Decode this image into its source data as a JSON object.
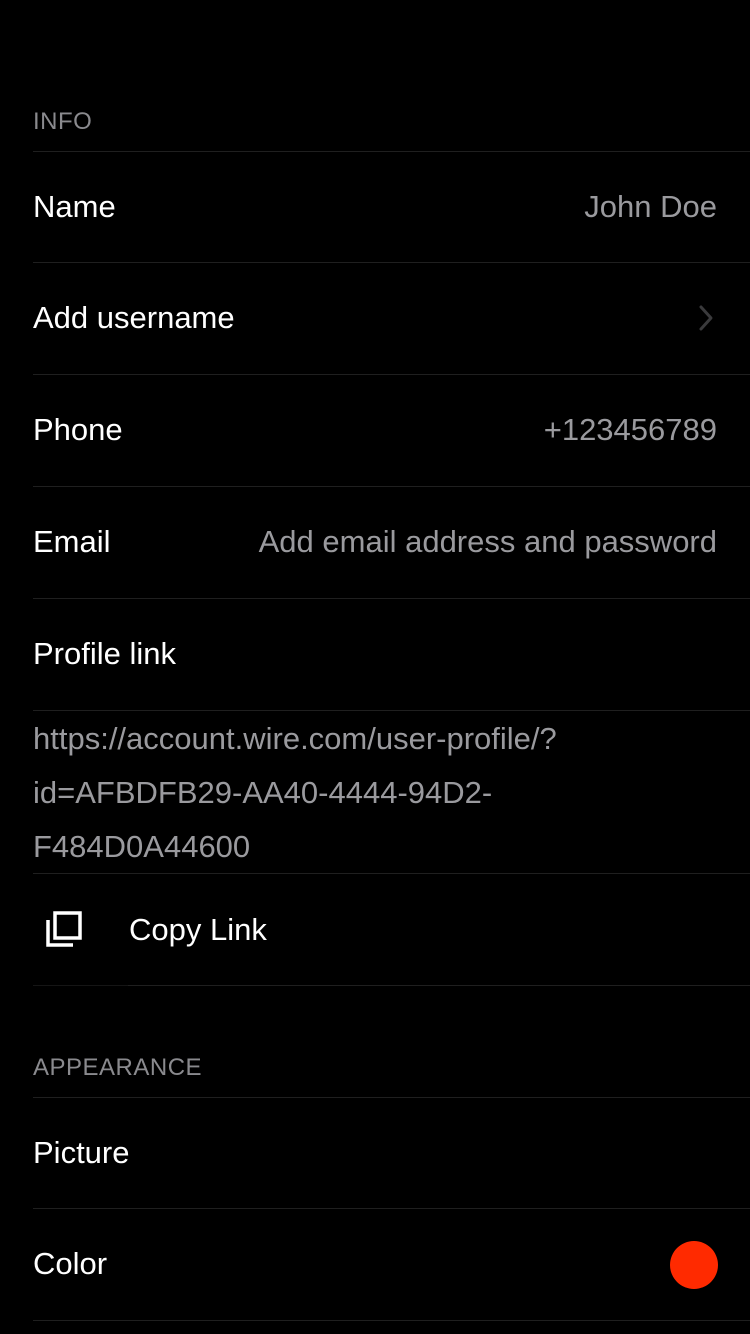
{
  "info_section": {
    "header": "INFO",
    "name_label": "Name",
    "name_value": "John Doe",
    "username_label": "Add username",
    "phone_label": "Phone",
    "phone_value": "+123456789",
    "email_label": "Email",
    "email_value": "Add email address and password",
    "profile_link_label": "Profile link",
    "profile_link_lines": [
      "https://account.wire.com/user-profile/?",
      "id=AFBDFB29-AA40-4444-94D2-",
      "F484D0A44600"
    ],
    "copy_link_label": "Copy Link",
    "copy_icon": "copy-icon",
    "chevron_icon": "chevron-right-icon"
  },
  "appearance_section": {
    "header": "APPEARANCE",
    "picture_label": "Picture",
    "color_label": "Color",
    "accent_color": "#ff2a00"
  }
}
